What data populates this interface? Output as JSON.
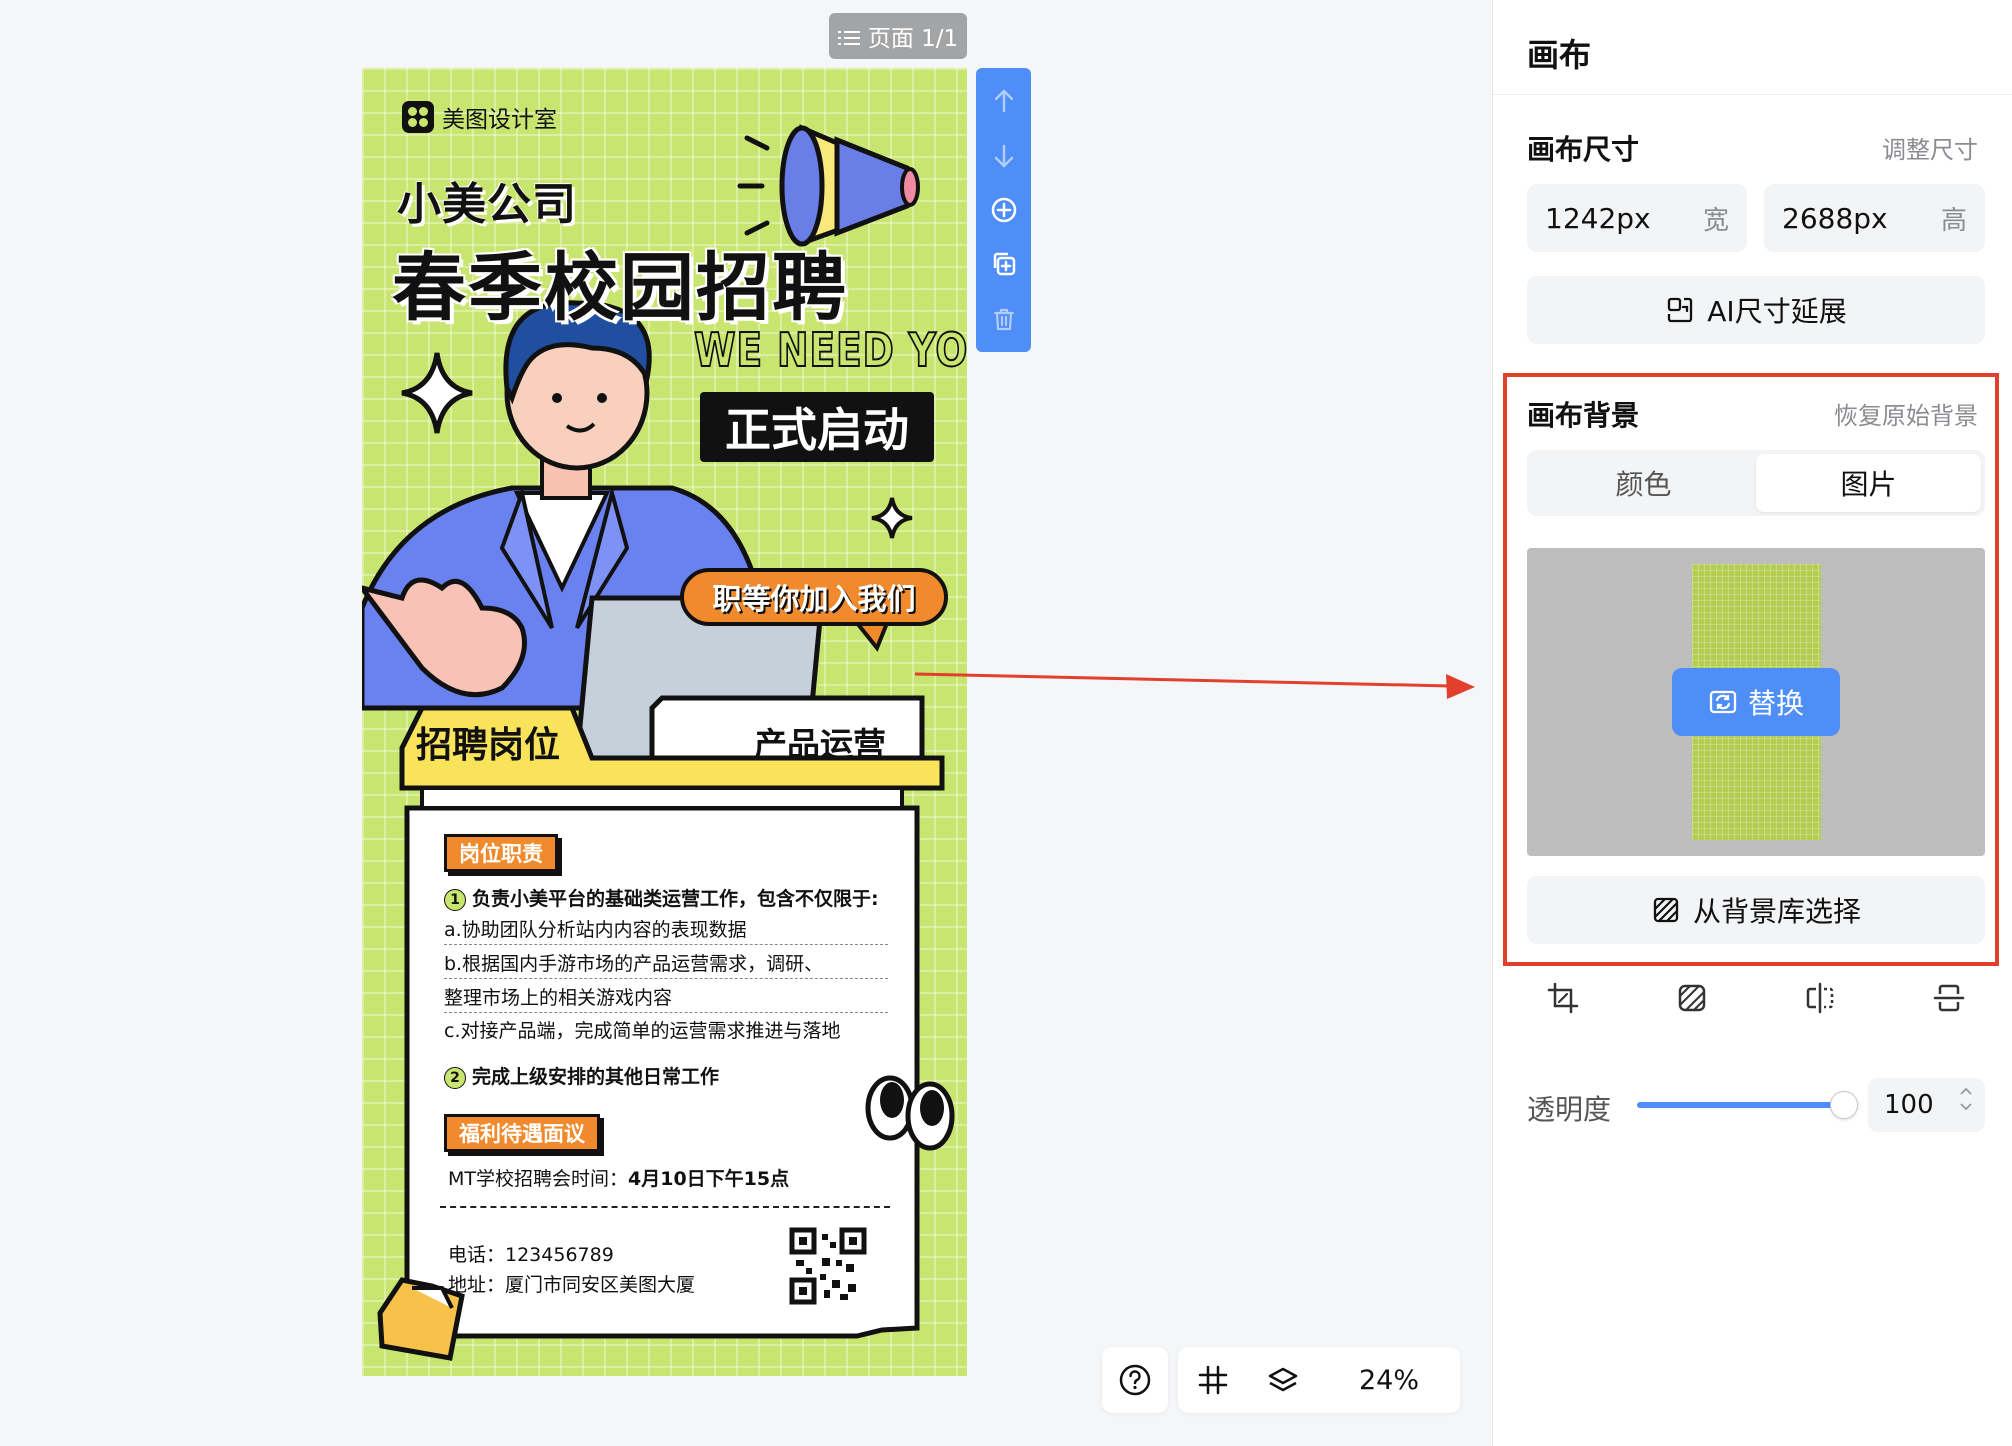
{
  "page_indicator": {
    "label": "页面 1/1"
  },
  "poster": {
    "brand": "美图设计室",
    "company": "小美公司",
    "headline": "春季校园招聘",
    "slogan": "WE NEED YOU",
    "launch": "正式启动",
    "join_bubble": "职等你加入我们",
    "tab_recruit": "招聘岗位",
    "tab_position": "产品运营",
    "section_duties": "岗位职责",
    "duties": [
      {
        "num": "1",
        "text": "负责小美平台的基础类运营工作，包含不仅限于:"
      },
      {
        "num": "",
        "text": "a.协助团队分析站内内容的表现数据"
      },
      {
        "num": "",
        "text": "b.根据国内手游市场的产品运营需求，调研、"
      },
      {
        "num": "",
        "text": "整理市场上的相关游戏内容"
      },
      {
        "num": "",
        "text": "c.对接产品端，完成简单的运营需求推进与落地"
      },
      {
        "num": "2",
        "text": "完成上级安排的其他日常工作"
      }
    ],
    "section_benefits": "福利待遇面议",
    "meeting_prefix": "MT学校招聘会时间：",
    "meeting_time": "4月10日下午15点",
    "phone": "电话：123456789",
    "address": "地址：厦门市同安区美图大厦"
  },
  "float_toolbar": {
    "icons": [
      "arrow-up-icon",
      "arrow-down-icon",
      "add-page-icon",
      "copy-page-icon",
      "delete-icon"
    ]
  },
  "bottom_tools": {
    "zoom": "24%"
  },
  "panel": {
    "title": "画布",
    "size_section": {
      "title": "画布尺寸",
      "action": "调整尺寸",
      "width_value": "1242px",
      "width_unit": "宽",
      "height_value": "2688px",
      "height_unit": "高",
      "ai_extend": "AI尺寸延展"
    },
    "bg_section": {
      "title": "画布背景",
      "action": "恢复原始背景",
      "tabs": [
        "颜色",
        "图片"
      ],
      "active_tab": "图片",
      "replace": "替换",
      "library": "从背景库选择"
    },
    "opacity": {
      "label": "透明度",
      "value": "100",
      "level": 1.0
    }
  },
  "colors": {
    "accent": "#4f8ef7",
    "poster_bg": "#c8e56f",
    "orange": "#f08a2d",
    "highlight": "#e0402c"
  }
}
